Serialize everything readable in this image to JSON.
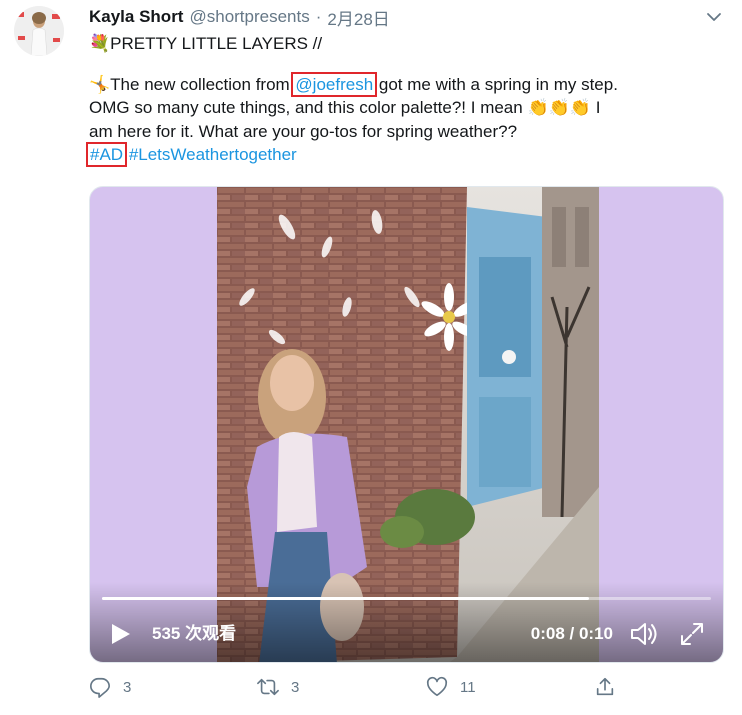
{
  "user": {
    "display_name": "Kayla Short",
    "handle": "@shortpresents",
    "separator": "·",
    "date": "2月28日"
  },
  "tweet": {
    "line1": {
      "emoji": "💐",
      "text": "PRETTY LITTLE LAYERS //"
    },
    "line2": {
      "emoji": "🤸",
      "pre": "The new collection from ",
      "mention": "@joefresh",
      "post": " got me with a spring in my step."
    },
    "line3": {
      "pre": "OMG so many cute things, and this color palette?! I mean ",
      "emoji": "👏👏👏",
      "post": " I"
    },
    "line4": {
      "text": "am here for it. What are your go-tos for spring weather??"
    },
    "hashtag_ad": "#AD",
    "hashtag_weather": "#LetsWeathertogether"
  },
  "video": {
    "views": "535 次观看",
    "timecode": "0:08 / 0:10",
    "progress": 0.8
  },
  "actions": {
    "reply_count": "3",
    "retweet_count": "3",
    "like_count": "11"
  },
  "colors": {
    "link": "#1b95e0",
    "highlight_box": "#e0262b",
    "muted": "#657786",
    "video_bg": "#d6c3ef"
  }
}
